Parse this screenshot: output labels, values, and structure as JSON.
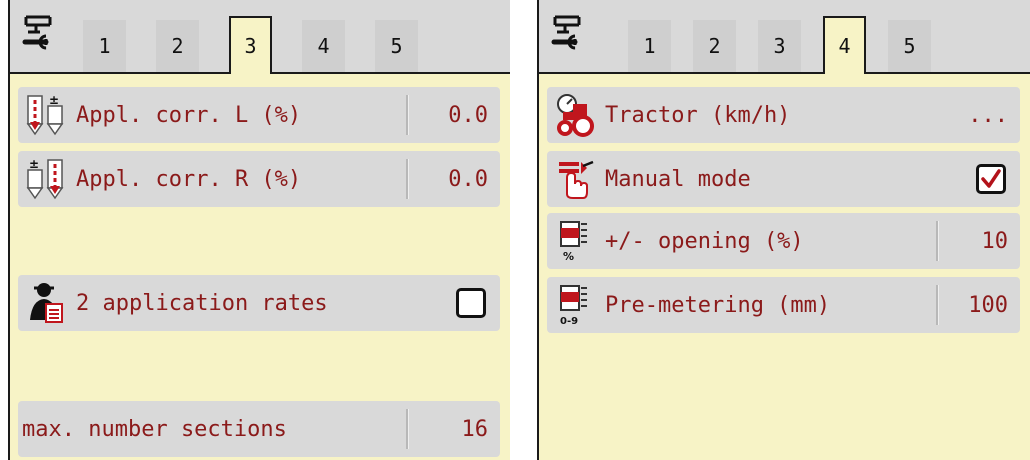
{
  "left_panel": {
    "tabs": [
      "1",
      "2",
      "3",
      "4",
      "5"
    ],
    "active_tab": "3",
    "rows": {
      "appl_corr_l": {
        "label": "Appl. corr. L (%)",
        "value": "0.0",
        "icon": "left-correction-icon"
      },
      "appl_corr_r": {
        "label": "Appl. corr. R (%)",
        "value": "0.0",
        "icon": "right-correction-icon"
      },
      "two_rates": {
        "label": "2 application rates",
        "checked": false,
        "icon": "operator-icon"
      },
      "max_sections": {
        "label": "max. number sections",
        "value": "16"
      }
    }
  },
  "right_panel": {
    "tabs": [
      "1",
      "2",
      "3",
      "4",
      "5"
    ],
    "active_tab": "4",
    "rows": {
      "tractor": {
        "label": "Tractor (km/h)",
        "value": "...",
        "icon": "tractor-icon"
      },
      "manual_mode": {
        "label": "Manual mode",
        "checked": true,
        "icon": "manual-mode-icon"
      },
      "opening": {
        "label": "+/- opening (%)",
        "value": "10",
        "icon": "opening-icon",
        "icon_caption": "%"
      },
      "pre_metering": {
        "label": "Pre-metering (mm)",
        "value": "100",
        "icon": "pre-metering-icon",
        "icon_caption": "0-9"
      }
    }
  },
  "colors": {
    "panel_bg": "#f7f3c6",
    "row_bg": "#d9d9d9",
    "text": "#8b1a1a",
    "tab_bg": "#cfcfcf",
    "check_red": "#b3121a"
  }
}
